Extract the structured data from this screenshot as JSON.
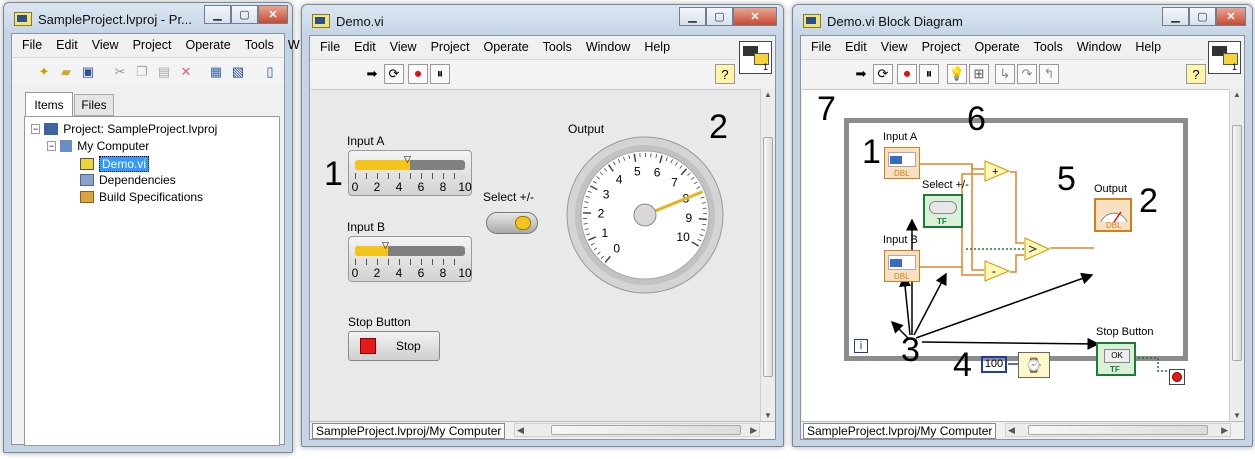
{
  "project_window": {
    "title": "SampleProject.lvproj - Pr...",
    "menu": [
      "File",
      "Edit",
      "View",
      "Project",
      "Operate",
      "Tools",
      "W"
    ],
    "tabs": [
      {
        "label": "Items",
        "active": true
      },
      {
        "label": "Files",
        "active": false
      }
    ],
    "tree": [
      {
        "label": "Project: SampleProject.lvproj",
        "icon": "project-icon"
      },
      {
        "label": "My Computer",
        "icon": "computer-icon"
      },
      {
        "label": "Demo.vi",
        "icon": "vi-icon",
        "selected": true
      },
      {
        "label": "Dependencies",
        "icon": "dependencies-icon"
      },
      {
        "label": "Build Specifications",
        "icon": "build-specifications-icon"
      }
    ]
  },
  "front_panel": {
    "title": "Demo.vi",
    "menu": [
      "File",
      "Edit",
      "View",
      "Project",
      "Operate",
      "Tools",
      "Window",
      "Help"
    ],
    "input_a": {
      "label": "Input A",
      "value": 5,
      "ticks": [
        "0",
        "2",
        "4",
        "6",
        "8",
        "10"
      ]
    },
    "input_b": {
      "label": "Input B",
      "value": 3,
      "ticks": [
        "0",
        "2",
        "4",
        "6",
        "8",
        "10"
      ]
    },
    "select_label": "Select +/-",
    "output_label": "Output",
    "gauge_ticks": [
      "0",
      "1",
      "2",
      "3",
      "4",
      "5",
      "6",
      "7",
      "8",
      "9",
      "10"
    ],
    "gauge_value": 8,
    "stop_label": "Stop Button",
    "stop_button_text": "Stop",
    "callouts": [
      "1",
      "2"
    ],
    "path": "SampleProject.lvproj/My Computer",
    "vicon_number": "1"
  },
  "block_diagram": {
    "title": "Demo.vi Block Diagram",
    "menu": [
      "File",
      "Edit",
      "View",
      "Project",
      "Operate",
      "Tools",
      "Window",
      "Help"
    ],
    "input_a_label": "Input A",
    "input_b_label": "Input B",
    "select_label": "Select +/-",
    "output_label": "Output",
    "stop_label": "Stop Button",
    "dbl_tag": "DBL",
    "tf_tag": "TF",
    "ok_text": "OK",
    "plus": "+",
    "minus": "-",
    "wait_constant": "100",
    "iteration": "i",
    "callouts": [
      "7",
      "1",
      "6",
      "5",
      "2",
      "3",
      "4"
    ],
    "path": "SampleProject.lvproj/My Computer",
    "vicon_number": "1"
  },
  "colors": {
    "accent_yellow": "#f3c41b",
    "wire_orange": "#e0862a",
    "wire_green": "#1e7a2e",
    "stop_red": "#e51b1b",
    "selection_blue": "#3399ff"
  }
}
